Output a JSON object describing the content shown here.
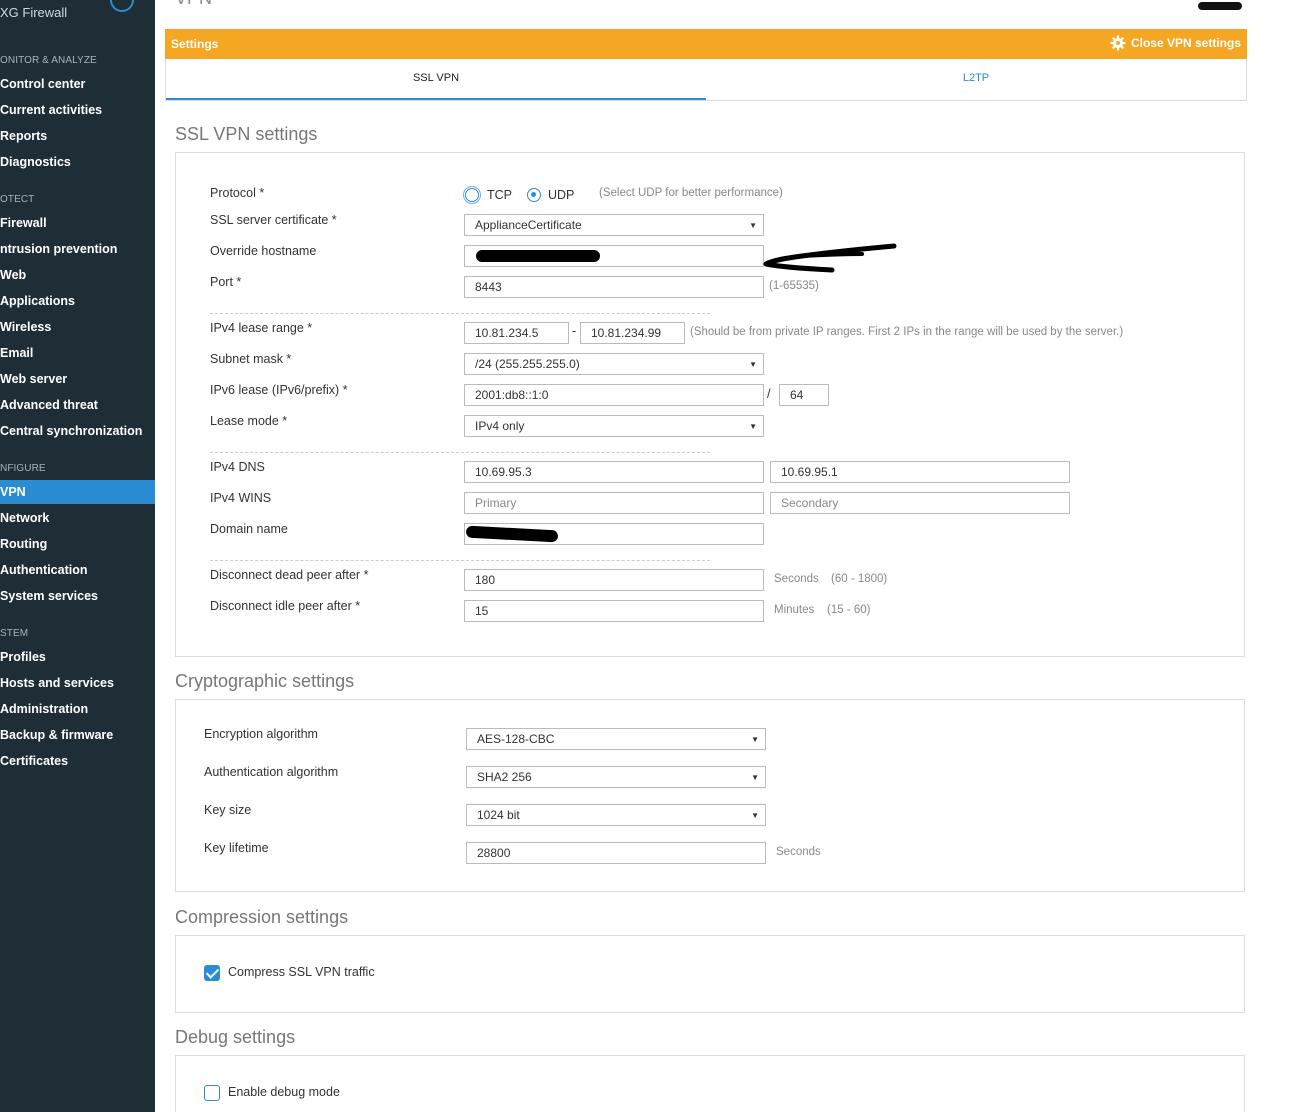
{
  "sidebar": {
    "brand": "XG Firewall",
    "sections": {
      "monitor": "ONITOR & ANALYZE",
      "protect": "OTECT",
      "configure": "NFIGURE",
      "system": "STEM"
    },
    "monitor_items": [
      "Control center",
      "Current activities",
      "Reports",
      "Diagnostics"
    ],
    "protect_items": [
      "Firewall",
      "ntrusion prevention",
      "Web",
      "Applications",
      "Wireless",
      "Email",
      "Web server",
      "Advanced threat",
      "Central synchronization"
    ],
    "configure_items": [
      "VPN",
      "Network",
      "Routing",
      "Authentication",
      "System services"
    ],
    "system_items": [
      "Profiles",
      "Hosts and services",
      "Administration",
      "Backup & firmware",
      "Certificates"
    ]
  },
  "header": {
    "title": "VPN"
  },
  "settings_bar": {
    "title": "Settings",
    "close_label": "Close VPN settings"
  },
  "tabs": {
    "ssl": "SSL VPN",
    "l2tp": "L2TP"
  },
  "ssl_vpn": {
    "heading": "SSL VPN settings",
    "protocol_label": "Protocol *",
    "tcp": "TCP",
    "udp": "UDP",
    "protocol_hint": "(Select UDP for better performance)",
    "cert_label": "SSL server certificate *",
    "cert_value": "ApplianceCertificate",
    "override_label": "Override hostname",
    "port_label": "Port *",
    "port_value": "8443",
    "port_hint": "(1-65535)",
    "lease_label": "IPv4 lease range *",
    "lease_start": "10.81.234.5",
    "lease_dash": "-",
    "lease_end": "10.81.234.99",
    "lease_hint": "(Should be from private IP ranges. First 2 IPs in the range will be used by the server.)",
    "subnet_label": "Subnet mask *",
    "subnet_value": "/24 (255.255.255.0)",
    "ipv6_label": "IPv6 lease (IPv6/prefix) *",
    "ipv6_value": "2001:db8::1:0",
    "ipv6_slash": "/",
    "ipv6_prefix": "64",
    "mode_label": "Lease mode *",
    "mode_value": "IPv4 only",
    "dns_label": "IPv4 DNS",
    "dns1": "10.69.95.3",
    "dns2": "10.69.95.1",
    "wins_label": "IPv4 WINS",
    "wins_primary": "Primary",
    "wins_secondary": "Secondary",
    "domain_label": "Domain name",
    "dead_label": "Disconnect dead peer after *",
    "dead_value": "180",
    "dead_unit": "Seconds",
    "dead_range": "(60 - 1800)",
    "idle_label": "Disconnect idle peer after *",
    "idle_value": "15",
    "idle_unit": "Minutes",
    "idle_range": "(15 - 60)"
  },
  "crypto": {
    "heading": "Cryptographic settings",
    "enc_label": "Encryption algorithm",
    "enc_value": "AES-128-CBC",
    "auth_label": "Authentication algorithm",
    "auth_value": "SHA2 256",
    "key_label": "Key size",
    "key_value": "1024 bit",
    "life_label": "Key lifetime",
    "life_value": "28800",
    "life_unit": "Seconds"
  },
  "compression": {
    "heading": "Compression settings",
    "label": "Compress SSL VPN traffic",
    "checked": true
  },
  "debug": {
    "heading": "Debug settings",
    "label": "Enable debug mode",
    "checked": false
  },
  "colors": {
    "accent": "#2a8dd4",
    "settings_bar": "#f5a623",
    "sidebar": "#1e2d36"
  }
}
